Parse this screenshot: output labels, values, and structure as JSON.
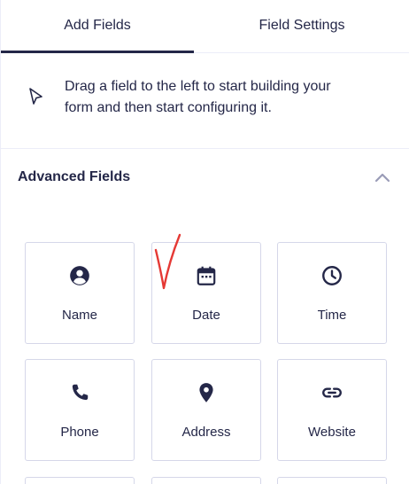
{
  "tabs": {
    "add_fields": "Add Fields",
    "field_settings": "Field Settings"
  },
  "notice": {
    "icon": "cursor-arrow-icon",
    "line1": "Drag a field to the left to start building your",
    "line2": "form and then start configuring it."
  },
  "section": {
    "title": "Advanced Fields",
    "state": "expanded"
  },
  "fields": [
    {
      "label": "Name",
      "icon": "user-circle-icon"
    },
    {
      "label": "Date",
      "icon": "calendar-icon"
    },
    {
      "label": "Time",
      "icon": "clock-icon"
    },
    {
      "label": "Phone",
      "icon": "phone-icon"
    },
    {
      "label": "Address",
      "icon": "map-pin-icon"
    },
    {
      "label": "Website",
      "icon": "link-icon"
    }
  ],
  "colors": {
    "text": "#242748",
    "border": "#d5d7e9",
    "divider": "#ecedf8",
    "chevron": "#9a9cb7",
    "annotation": "#e53935"
  }
}
